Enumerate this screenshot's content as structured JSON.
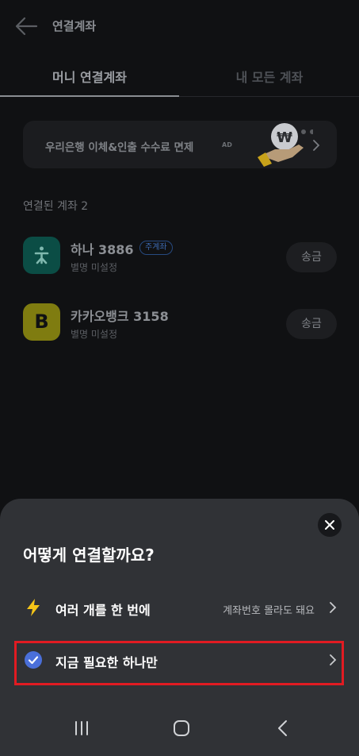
{
  "header": {
    "title": "연결계좌"
  },
  "tabs": [
    {
      "label": "머니 연결계좌",
      "active": true
    },
    {
      "label": "내 모든 계좌",
      "active": false
    }
  ],
  "banner": {
    "text": "우리은행 이체&인출 수수료 면제",
    "ad_label": "AD",
    "coin_symbol": "₩"
  },
  "section": {
    "label": "연결된 계좌 2"
  },
  "accounts": [
    {
      "bank_icon": "hana-bank-logo",
      "name": "하나 3886",
      "badge": "주계좌",
      "nickname": "별명 미설정",
      "action_label": "송금"
    },
    {
      "bank_icon": "kakaobank-logo",
      "logo_letter": "B",
      "name": "카카오뱅크 3158",
      "nickname": "별명 미설정",
      "action_label": "송금"
    }
  ],
  "sheet": {
    "title": "어떻게 연결할까요?",
    "options": [
      {
        "icon": "lightning-icon",
        "label": "여러 개를 한 번에",
        "hint": "계좌번호 몰라도 돼요"
      },
      {
        "icon": "check-circle-icon",
        "label": "지금 필요한 하나만",
        "hint": ""
      }
    ],
    "highlight_color": "#e11b22"
  },
  "colors": {
    "background": "#101113",
    "sheet": "#303236",
    "accent_blue": "#4a6fd9",
    "lightning": "#f5c518"
  }
}
